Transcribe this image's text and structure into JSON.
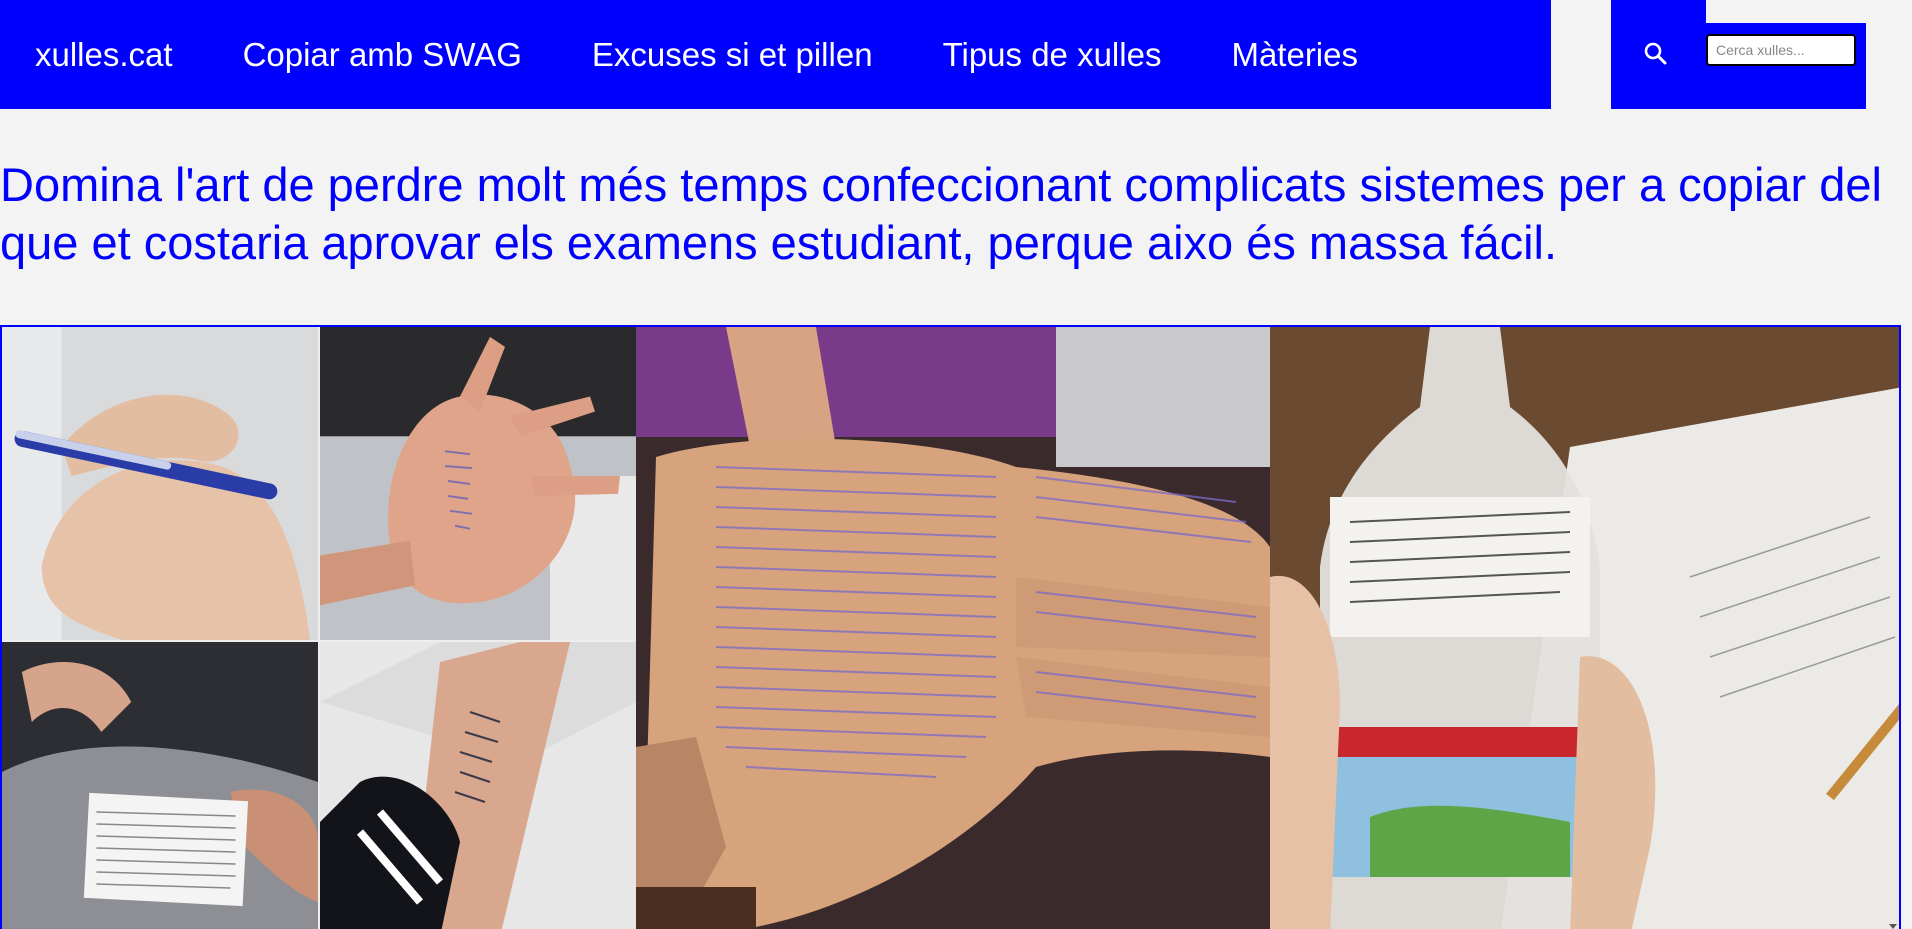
{
  "nav": {
    "items": [
      {
        "label": "xulles.cat"
      },
      {
        "label": "Copiar amb SWAG"
      },
      {
        "label": "Excuses si et pillen"
      },
      {
        "label": "Tipus de xulles"
      },
      {
        "label": "Màteries"
      }
    ],
    "search_placeholder": "Cerca xulles...",
    "search_icon": "magnifier"
  },
  "headline": "Domina l'art de perdre molt més temps confeccionant complicats sistemes per a copiar del que et costaria aprovar els examens estudiant, perque aixo és massa fácil.",
  "colors": {
    "brand_blue": "#0000fe",
    "page_background": "#f3f3f3"
  }
}
